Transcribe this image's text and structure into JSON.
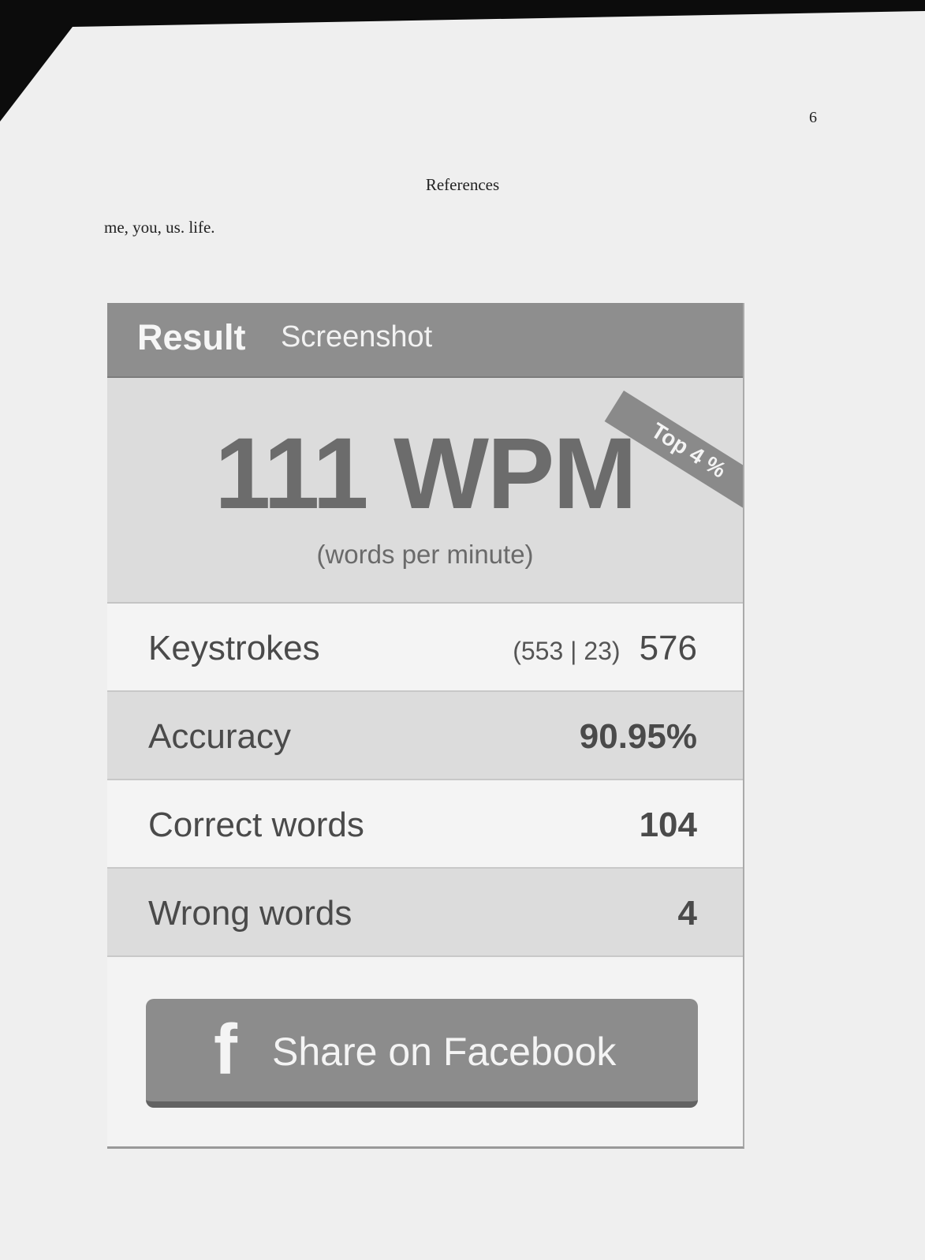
{
  "document": {
    "page_number": "6",
    "heading": "References",
    "entry": "me, you, us. life."
  },
  "result_card": {
    "tabs": {
      "active": "Result",
      "inactive": "Screenshot"
    },
    "badge": "Top 4 %",
    "speed": "111 WPM",
    "speed_caption": "(words per minute)",
    "stats": [
      {
        "label": "Keystrokes",
        "detail": "(553 | 23)",
        "value": "576"
      },
      {
        "label": "Accuracy",
        "value": "90.95%"
      },
      {
        "label": "Correct words",
        "value": "104"
      },
      {
        "label": "Wrong words",
        "value": "4"
      }
    ],
    "share_button": {
      "icon": "facebook-icon",
      "icon_glyph": "f",
      "label": "Share on Facebook"
    }
  }
}
